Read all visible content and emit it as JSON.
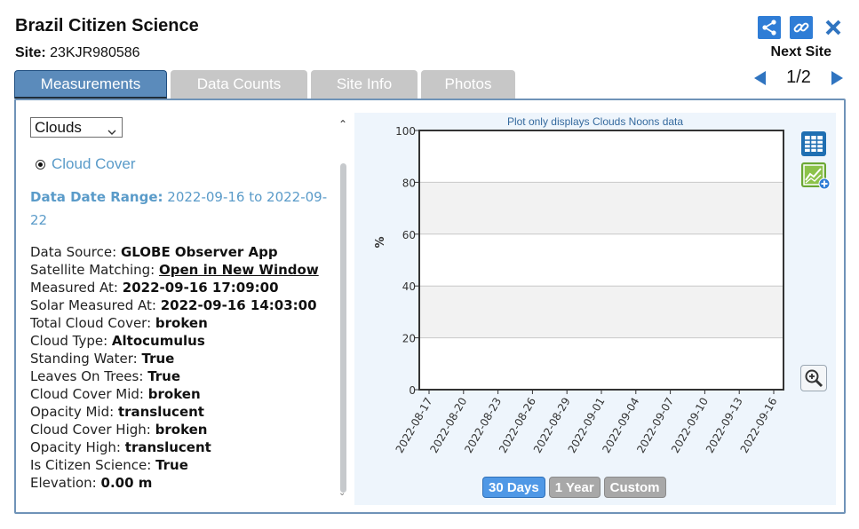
{
  "header": {
    "title": "Brazil Citizen Science",
    "site_label": "Site:",
    "site_value": "23KJR980586",
    "share_icon": "share-icon",
    "link_icon": "link-icon",
    "close_icon": "close-icon",
    "next_site_label": "Next Site",
    "pager": "1/2"
  },
  "tabs": [
    {
      "label": "Measurements",
      "active": true
    },
    {
      "label": "Data Counts",
      "active": false
    },
    {
      "label": "Site Info",
      "active": false
    },
    {
      "label": "Photos",
      "active": false
    }
  ],
  "left": {
    "select_value": "Clouds",
    "radio_label": "Cloud Cover",
    "range_label": "Data Date Range:",
    "range_value": "2022-09-16 to 2022-09-22",
    "details": [
      {
        "label": "Data Source:",
        "value": "GLOBE Observer App"
      },
      {
        "label": "Satellite Matching:",
        "value": "Open in New Window",
        "link": true
      },
      {
        "label": "Measured At:",
        "value": "2022-09-16 17:09:00"
      },
      {
        "label": "Solar Measured At:",
        "value": "2022-09-16 14:03:00"
      },
      {
        "label": "Total Cloud Cover:",
        "value": "broken"
      },
      {
        "label": "Cloud Type:",
        "value": "Altocumulus"
      },
      {
        "label": "Standing Water:",
        "value": "True"
      },
      {
        "label": "Leaves On Trees:",
        "value": "True"
      },
      {
        "label": "Cloud Cover Mid:",
        "value": "broken"
      },
      {
        "label": "Opacity Mid:",
        "value": "translucent"
      },
      {
        "label": "Cloud Cover High:",
        "value": "broken"
      },
      {
        "label": "Opacity High:",
        "value": "translucent"
      },
      {
        "label": "Is Citizen Science:",
        "value": "True"
      },
      {
        "label": "Elevation:",
        "value": "0.00 m"
      }
    ]
  },
  "chart": {
    "note": "Plot only displays Clouds Noons data",
    "table_icon": "table-icon",
    "add_chart_icon": "add-chart-icon",
    "zoom_icon": "zoom-in-icon",
    "range_buttons": [
      {
        "label": "30 Days",
        "active": true
      },
      {
        "label": "1 Year",
        "active": false
      },
      {
        "label": "Custom",
        "active": false
      }
    ]
  },
  "chart_data": {
    "type": "line",
    "title": "",
    "subtitle": "Plot only displays Clouds Noons data",
    "xlabel": "",
    "ylabel": "%",
    "ylim": [
      0,
      100
    ],
    "yticks": [
      0,
      20,
      40,
      60,
      80,
      100
    ],
    "x_ticks": [
      "2022-08-17",
      "2022-08-20",
      "2022-08-23",
      "2022-08-26",
      "2022-08-29",
      "2022-09-01",
      "2022-09-04",
      "2022-09-07",
      "2022-09-10",
      "2022-09-13",
      "2022-09-16"
    ],
    "series": [],
    "grid": true,
    "band_colors": [
      "#ffffff",
      "#f2f2f2"
    ]
  }
}
